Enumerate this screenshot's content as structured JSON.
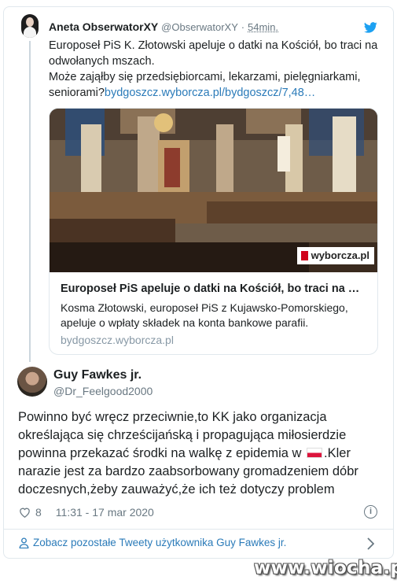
{
  "parent_tweet": {
    "author_name": "Aneta ObserwatorXY",
    "author_handle": "@ObserwatorXY",
    "separator": "·",
    "time": "54min.",
    "text_line1": "Europoseł PiS K. Złotowski apeluje o datki na Kościół, bo traci na odwołanych mszach.",
    "text_line2": "Może zająłby się przedsiębiorcami, lekarzami, pielęgniarkami, seniorami?",
    "link_text": "bydgoszcz.wyborcza.pl/bydgoszcz/7,48…",
    "link_card": {
      "title": "Europoseł PiS apeluje o datki na Kościół, bo traci na …",
      "description": "Kosma Złotowski, europoseł PiS z Kujawsko-Pomorskiego, apeluje o wpłaty składek na konta bankowe parafii.",
      "domain": "bydgoszcz.wyborcza.pl",
      "image_badge": "wyborcza.pl"
    }
  },
  "main_tweet": {
    "author_name": "Guy Fawkes jr.",
    "author_handle": "@Dr_Feelgood2000",
    "text_before_flag": "Powinno być wręcz przeciwnie,to KK jako organizacja określająca się chrześcijańską i propagująca miłosierdzie powinna przekazać środki na walkę z epidemia w ",
    "text_after_flag": ".Kler narazie jest  za bardzo zaabsorbowany gromadzeniem dóbr doczesnych,żeby zauważyć,że ich też dotyczy problem",
    "like_count": "8",
    "timestamp": "11:31 - 17 mar 2020",
    "info_glyph": "i"
  },
  "footer": {
    "more_tweets_label": "Zobacz pozostałe Tweety użytkownika Guy Fawkes jr."
  },
  "watermark": "www.wiocha.pl",
  "colors": {
    "link_blue": "#2b7bb9",
    "muted_gray": "#697882",
    "border": "#e1e8ed",
    "twitter_blue": "#1da1f2",
    "wyborcza_red": "#d0021b"
  },
  "icons": [
    "twitter-bird-icon",
    "heart-icon",
    "info-icon",
    "person-icon",
    "chevron-right-icon",
    "poland-flag-emoji"
  ]
}
